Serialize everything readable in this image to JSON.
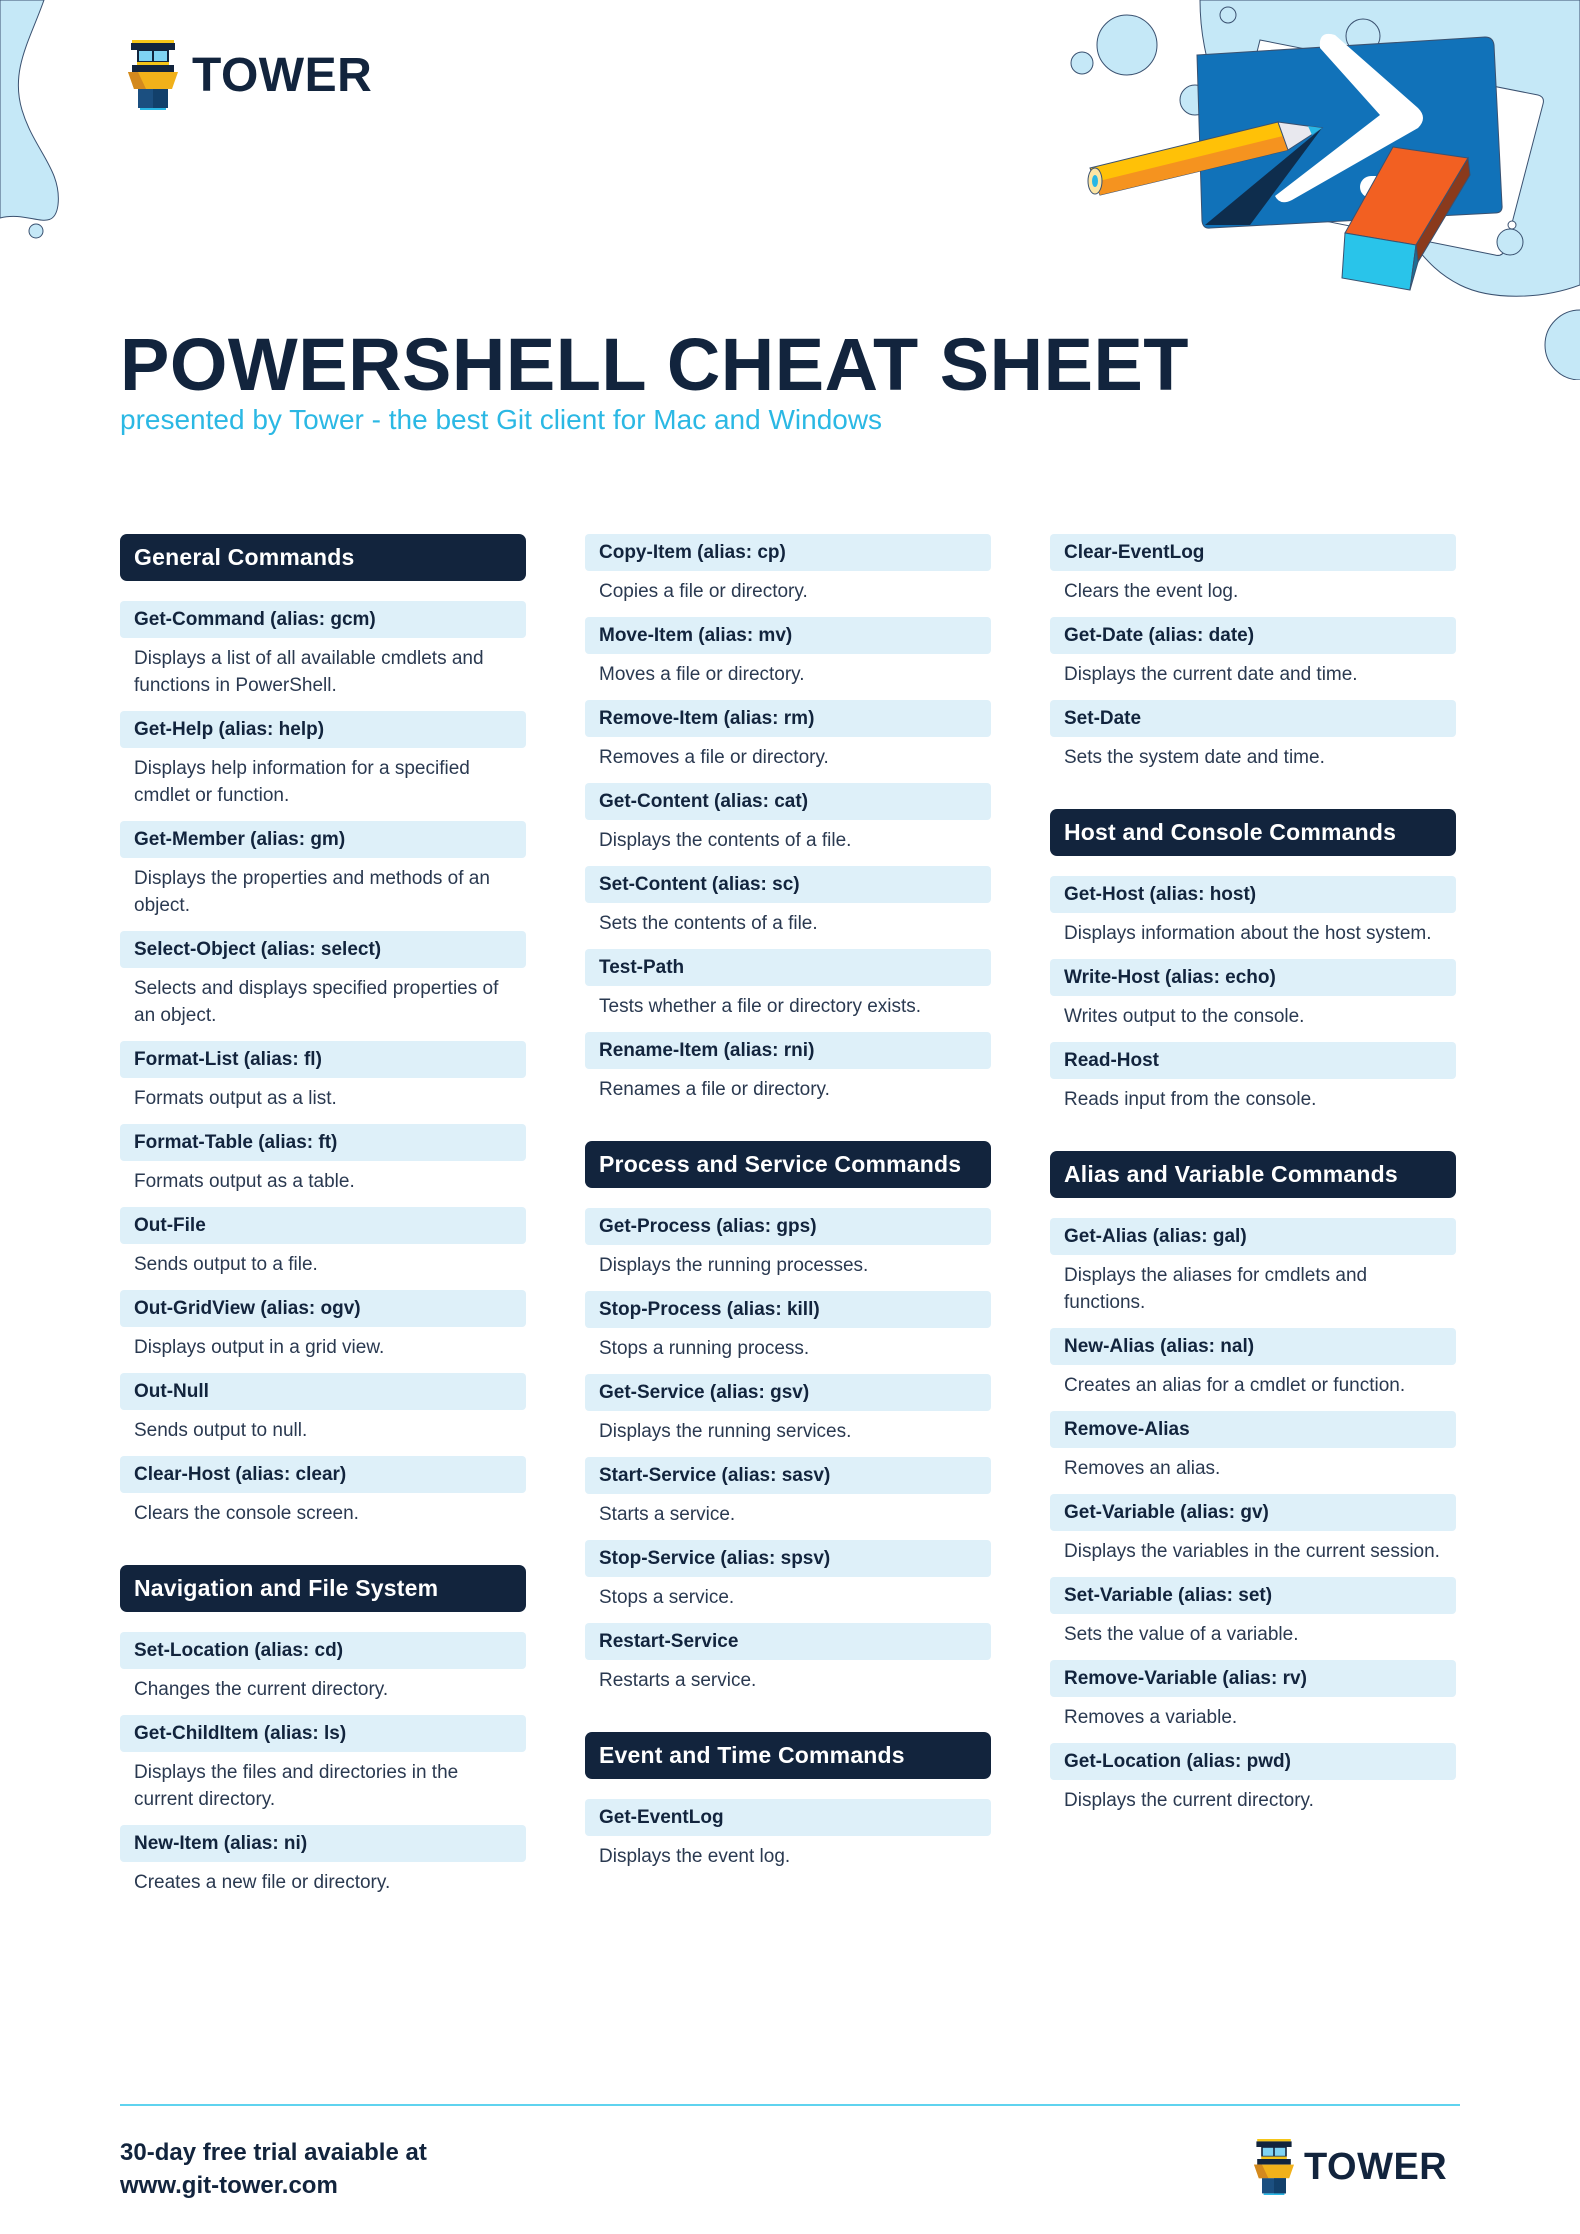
{
  "brand": {
    "name": "TOWER"
  },
  "header": {
    "title": "POWERSHELL CHEAT SHEET",
    "subtitle": "presented by Tower - the best Git client for Mac and Windows"
  },
  "colors": {
    "navy": "#12243d",
    "accent": "#2bb8e4",
    "command_bg": "#def0f9",
    "bubble": "#c5e8f7",
    "ps_blue": "#1172b9"
  },
  "columns": [
    {
      "sections": [
        {
          "title": "General Commands",
          "commands": [
            {
              "name": "Get-Command (alias: gcm)",
              "desc": "Displays a list of all available cmdlets and functions in PowerShell."
            },
            {
              "name": "Get-Help (alias: help)",
              "desc": "Displays help information for a specified cmdlet or function."
            },
            {
              "name": "Get-Member (alias: gm)",
              "desc": "Displays the properties and methods of an object."
            },
            {
              "name": "Select-Object (alias: select)",
              "desc": "Selects and displays specified properties of an object."
            },
            {
              "name": "Format-List (alias: fl)",
              "desc": "Formats output as a list."
            },
            {
              "name": "Format-Table (alias: ft)",
              "desc": "Formats output as a table."
            },
            {
              "name": "Out-File",
              "desc": "Sends output to a file."
            },
            {
              "name": "Out-GridView (alias: ogv)",
              "desc": "Displays output in a grid view."
            },
            {
              "name": "Out-Null",
              "desc": "Sends output to null."
            },
            {
              "name": "Clear-Host (alias: clear)",
              "desc": "Clears the console screen."
            }
          ]
        },
        {
          "title": "Navigation and File System",
          "commands": [
            {
              "name": "Set-Location (alias: cd)",
              "desc": "Changes the current directory."
            },
            {
              "name": "Get-ChildItem (alias: ls)",
              "desc": "Displays the files and directories in the current directory."
            },
            {
              "name": "New-Item (alias: ni)",
              "desc": "Creates a new file or directory."
            }
          ]
        }
      ]
    },
    {
      "sections": [
        {
          "title": "",
          "commands": [
            {
              "name": "Copy-Item (alias: cp)",
              "desc": "Copies a file or directory."
            },
            {
              "name": "Move-Item (alias: mv)",
              "desc": "Moves a file or directory."
            },
            {
              "name": "Remove-Item (alias: rm)",
              "desc": "Removes a file or directory."
            },
            {
              "name": "Get-Content (alias: cat)",
              "desc": "Displays the contents of a file."
            },
            {
              "name": "Set-Content (alias: sc)",
              "desc": "Sets the contents of a file."
            },
            {
              "name": "Test-Path",
              "desc": "Tests whether a file or directory exists."
            },
            {
              "name": "Rename-Item (alias: rni)",
              "desc": "Renames a file or directory."
            }
          ]
        },
        {
          "title": "Process and Service Commands",
          "commands": [
            {
              "name": "Get-Process (alias: gps)",
              "desc": "Displays the running processes."
            },
            {
              "name": "Stop-Process (alias: kill)",
              "desc": "Stops a running process."
            },
            {
              "name": "Get-Service (alias: gsv)",
              "desc": "Displays the running services."
            },
            {
              "name": "Start-Service (alias: sasv)",
              "desc": "Starts a service."
            },
            {
              "name": "Stop-Service (alias: spsv)",
              "desc": "Stops a service."
            },
            {
              "name": "Restart-Service",
              "desc": "Restarts a service."
            }
          ]
        },
        {
          "title": "Event and Time Commands",
          "commands": [
            {
              "name": "Get-EventLog",
              "desc": "Displays the event log."
            }
          ]
        }
      ]
    },
    {
      "sections": [
        {
          "title": "",
          "commands": [
            {
              "name": "Clear-EventLog",
              "desc": "Clears the event log."
            },
            {
              "name": "Get-Date (alias: date)",
              "desc": "Displays the current date and time."
            },
            {
              "name": "Set-Date",
              "desc": "Sets the system date and time."
            }
          ]
        },
        {
          "title": "Host and Console Commands",
          "commands": [
            {
              "name": "Get-Host (alias: host)",
              "desc": "Displays information about the host system."
            },
            {
              "name": "Write-Host (alias: echo)",
              "desc": "Writes output to the console."
            },
            {
              "name": "Read-Host",
              "desc": "Reads input from the console."
            }
          ]
        },
        {
          "title": "Alias and Variable Commands",
          "commands": [
            {
              "name": "Get-Alias (alias: gal)",
              "desc": "Displays the aliases for cmdlets and functions."
            },
            {
              "name": "New-Alias (alias: nal)",
              "desc": "Creates an alias for a cmdlet or function."
            },
            {
              "name": "Remove-Alias",
              "desc": "Removes an alias."
            },
            {
              "name": "Get-Variable (alias: gv)",
              "desc": "Displays the variables in the current session."
            },
            {
              "name": "Set-Variable (alias: set)",
              "desc": "Sets the value of a variable."
            },
            {
              "name": "Remove-Variable (alias: rv)",
              "desc": "Removes a variable."
            },
            {
              "name": "Get-Location (alias: pwd)",
              "desc": "Displays the current directory."
            }
          ]
        }
      ]
    }
  ],
  "footer": {
    "line1": "30-day free trial avaiable at",
    "line2": "www.git-tower.com"
  }
}
